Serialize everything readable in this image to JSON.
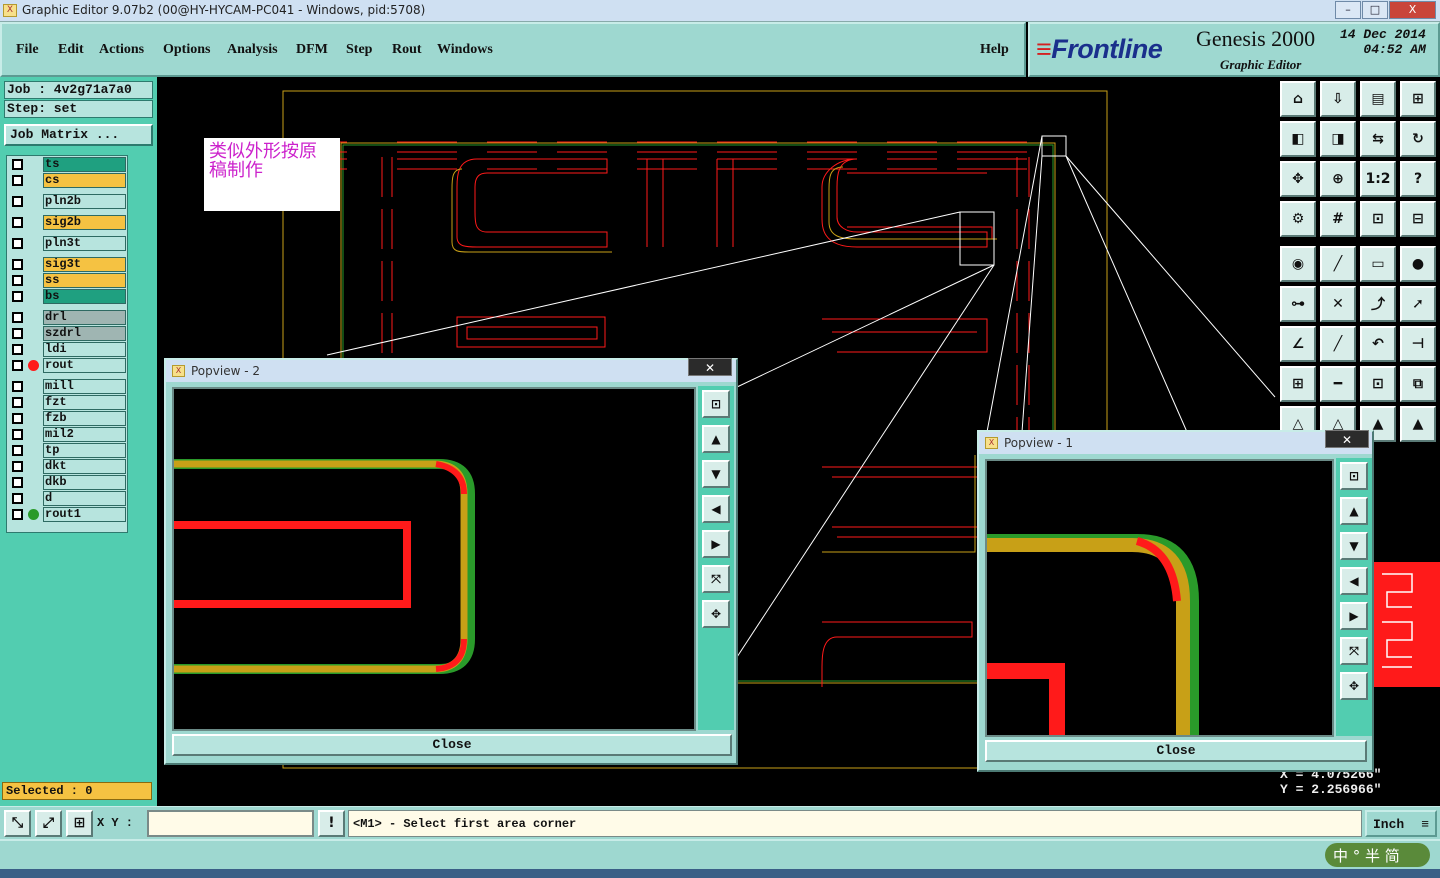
{
  "window": {
    "title": "Graphic Editor 9.07b2 (00@HY-HYCAM-PC041 - Windows, pid:5708)",
    "app_icon": "X"
  },
  "window_controls": {
    "minimize": "–",
    "restore": "□",
    "close": "X"
  },
  "menu": {
    "items": [
      "File",
      "Edit",
      "Actions",
      "Options",
      "Analysis",
      "DFM",
      "Step",
      "Rout",
      "Windows"
    ],
    "help": "Help"
  },
  "brand": {
    "logo_prefix": "≡",
    "logo": "Frontline",
    "product": "Genesis 2000",
    "subtitle": "Graphic Editor",
    "date": "14 Dec 2014",
    "time": "04:52 AM"
  },
  "job": {
    "job_label": "Job : 4v2g71a7a0",
    "step_label": "Step: set",
    "matrix_button": "Job Matrix ..."
  },
  "layers": [
    {
      "name": "ts",
      "color": "#1fa080"
    },
    {
      "name": "cs",
      "color": "#f5c242"
    },
    {
      "name": "pln2b",
      "color": "#b7e4de"
    },
    {
      "name": "sig2b",
      "color": "#f5c242"
    },
    {
      "name": "pln3t",
      "color": "#b7e4de"
    },
    {
      "name": "sig3t",
      "color": "#f5c242"
    },
    {
      "name": "ss",
      "color": "#f5c242"
    },
    {
      "name": "bs",
      "color": "#1fa080"
    },
    {
      "name": "drl",
      "color": "#9fb5b2"
    },
    {
      "name": "szdrl",
      "color": "#9fb5b2"
    },
    {
      "name": "ldi",
      "color": "#b7e4de"
    },
    {
      "name": "rout",
      "color": "#b7e4de",
      "marker": "#ff1a1a"
    },
    {
      "name": "mill",
      "color": "#b7e4de"
    },
    {
      "name": "fzt",
      "color": "#b7e4de"
    },
    {
      "name": "fzb",
      "color": "#b7e4de"
    },
    {
      "name": "mil2",
      "color": "#b7e4de"
    },
    {
      "name": "tp",
      "color": "#b7e4de"
    },
    {
      "name": "dkt",
      "color": "#b7e4de"
    },
    {
      "name": "dkb",
      "color": "#b7e4de"
    },
    {
      "name": "d",
      "color": "#b7e4de"
    },
    {
      "name": "rout1",
      "color": "#b7e4de",
      "marker": "#2a9a2a"
    }
  ],
  "selected": "Selected : 0",
  "annotation": {
    "line1": "类似外形按原",
    "line2": "稿制作"
  },
  "popview2": {
    "title": "Popview - 2",
    "close_x": "✕",
    "close": "Close"
  },
  "popview1": {
    "title": "Popview - 1",
    "close_x": "✕",
    "close": "Close"
  },
  "coords": {
    "x": "X = 4.075266\"",
    "y": "Y = 2.256966\""
  },
  "status": {
    "xy_label": "X Y :",
    "xy_value": "",
    "alert": "!",
    "prompt": "<M1> - Select first area corner",
    "units": "Inch"
  },
  "ime": {
    "label": "中 ° 半 简"
  },
  "colors": {
    "accent": "#9ed8d0",
    "panel": "#52cdb0",
    "highlight": "#f5c242",
    "rout_red": "#ff1a1a",
    "outline_yellow": "#c8a017",
    "green": "#2a9a2a"
  }
}
